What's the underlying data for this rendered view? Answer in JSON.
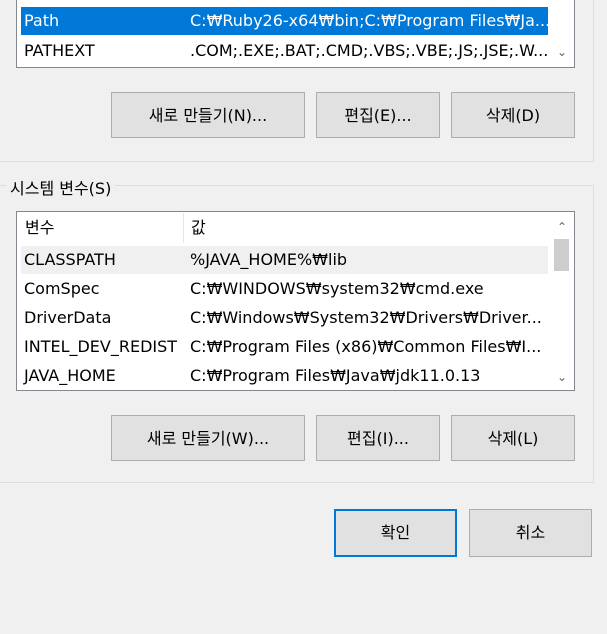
{
  "user_vars": {
    "rows": [
      {
        "name": "Path",
        "value": "C:₩Ruby26-x64₩bin;C:₩Program Files₩Ja..."
      },
      {
        "name": "PATHEXT",
        "value": ".COM;.EXE;.BAT;.CMD;.VBS;.VBE;.JS;.JSE;.W..."
      }
    ],
    "buttons": {
      "new": "새로 만들기(N)...",
      "edit": "편집(E)...",
      "delete": "삭제(D)"
    }
  },
  "system_vars": {
    "title": "시스템 변수(S)",
    "header": {
      "name": "변수",
      "value": "값"
    },
    "rows": [
      {
        "name": "CLASSPATH",
        "value": "%JAVA_HOME%₩lib"
      },
      {
        "name": "ComSpec",
        "value": "C:₩WINDOWS₩system32₩cmd.exe"
      },
      {
        "name": "DriverData",
        "value": "C:₩Windows₩System32₩Drivers₩Driver..."
      },
      {
        "name": "INTEL_DEV_REDIST",
        "value": "C:₩Program Files (x86)₩Common Files₩I..."
      },
      {
        "name": "JAVA_HOME",
        "value": "C:₩Program Files₩Java₩jdk11.0.13"
      }
    ],
    "buttons": {
      "new": "새로 만들기(W)...",
      "edit": "편집(I)...",
      "delete": "삭제(L)"
    }
  },
  "dialog_buttons": {
    "ok": "확인",
    "cancel": "취소"
  },
  "colors": {
    "selection": "#0078d7",
    "primary_border": "#0078d7"
  }
}
